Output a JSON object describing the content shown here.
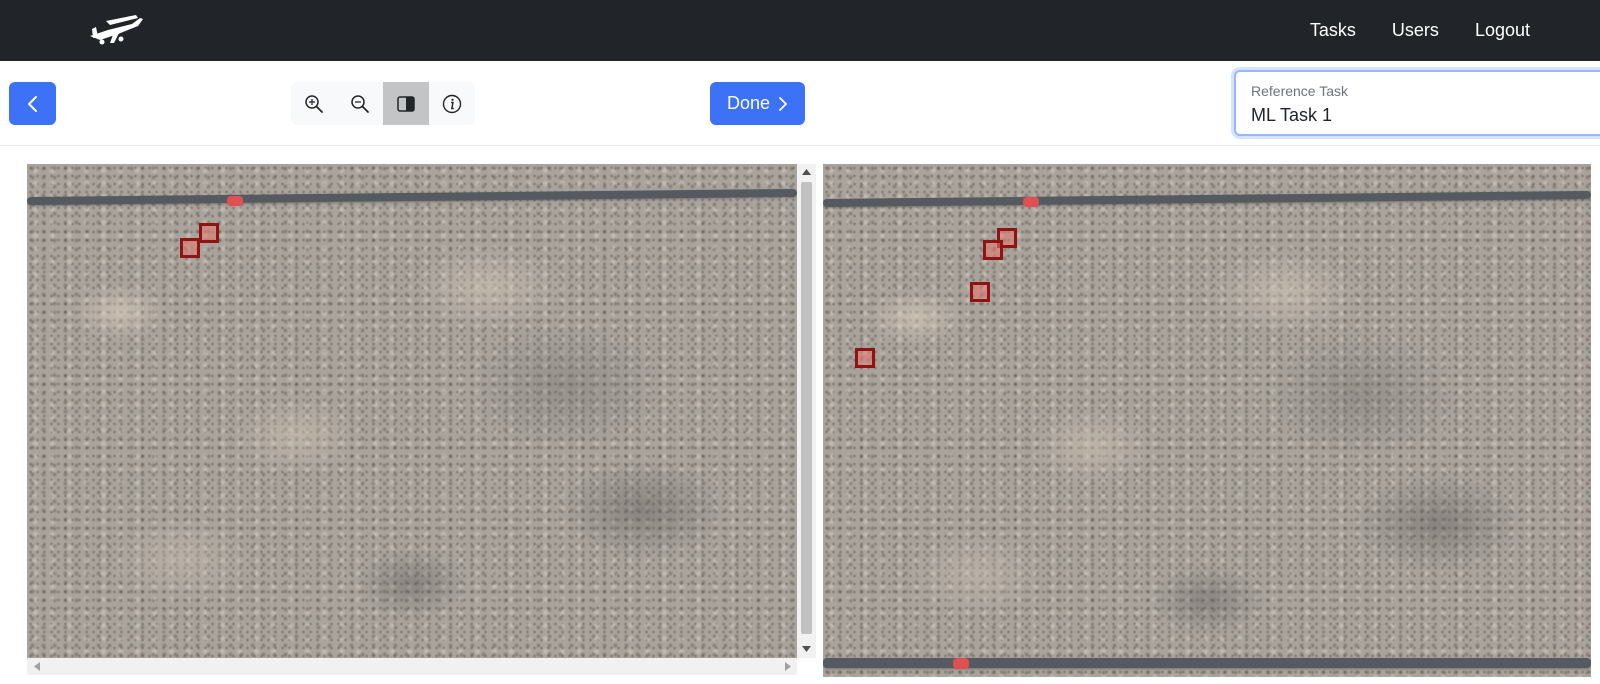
{
  "navbar": {
    "logo_icon": "airplane-icon",
    "links": [
      "Tasks",
      "Users",
      "Logout"
    ]
  },
  "toolbar": {
    "back_icon": "chevron-left-icon",
    "zoom_buttons": [
      {
        "icon": "zoom-in-icon",
        "active": false
      },
      {
        "icon": "zoom-out-icon",
        "active": false
      },
      {
        "icon": "split-view-icon",
        "active": true
      },
      {
        "icon": "info-icon",
        "active": false
      }
    ],
    "done_label": "Done",
    "done_icon": "chevron-right-icon",
    "reference_task": {
      "label": "Reference Task",
      "value": "ML Task 1"
    }
  },
  "colors": {
    "navbar_bg": "#212529",
    "primary": "#3d72f7",
    "bbox_border": "#8e1414",
    "focus_border": "#9ab6ff"
  },
  "images": {
    "left": {
      "annotation_count": 2
    },
    "right": {
      "annotation_count": 4
    }
  }
}
